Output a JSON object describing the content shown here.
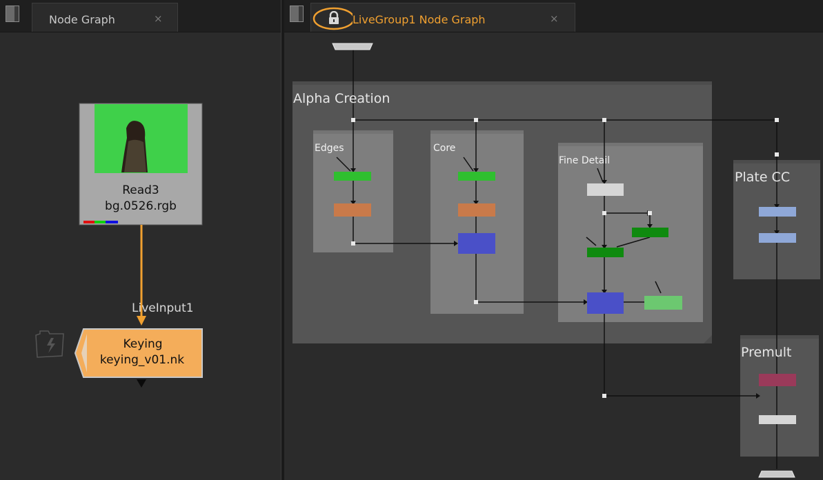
{
  "left_pane": {
    "tab": {
      "label": "Node Graph",
      "close": "×"
    },
    "read_node": {
      "name": "Read3",
      "file": "bg.0526.rgb"
    },
    "live_input_label": "LiveInput1",
    "live_group_node": {
      "name": "Keying",
      "file": "keying_v01.nk"
    }
  },
  "right_pane": {
    "tab": {
      "label": "LiveGroup1 Node Graph",
      "close": "×",
      "lock_icon": "lock-icon"
    },
    "backdrops": {
      "alpha_creation": "Alpha Creation",
      "edges": "Edges",
      "core": "Core",
      "fine_detail": "Fine Detail",
      "plate_cc": "Plate CC",
      "premult": "Premult"
    }
  },
  "colors": {
    "accent_orange": "#f0a030",
    "node_green": "#2fbf2f",
    "node_orange": "#c97a4a",
    "node_blue": "#4a50c8",
    "node_dark_green": "#0f8a0f",
    "node_light_green": "#6cc870",
    "node_light_blue": "#8fa8d8",
    "node_maroon": "#9a3a5a"
  }
}
